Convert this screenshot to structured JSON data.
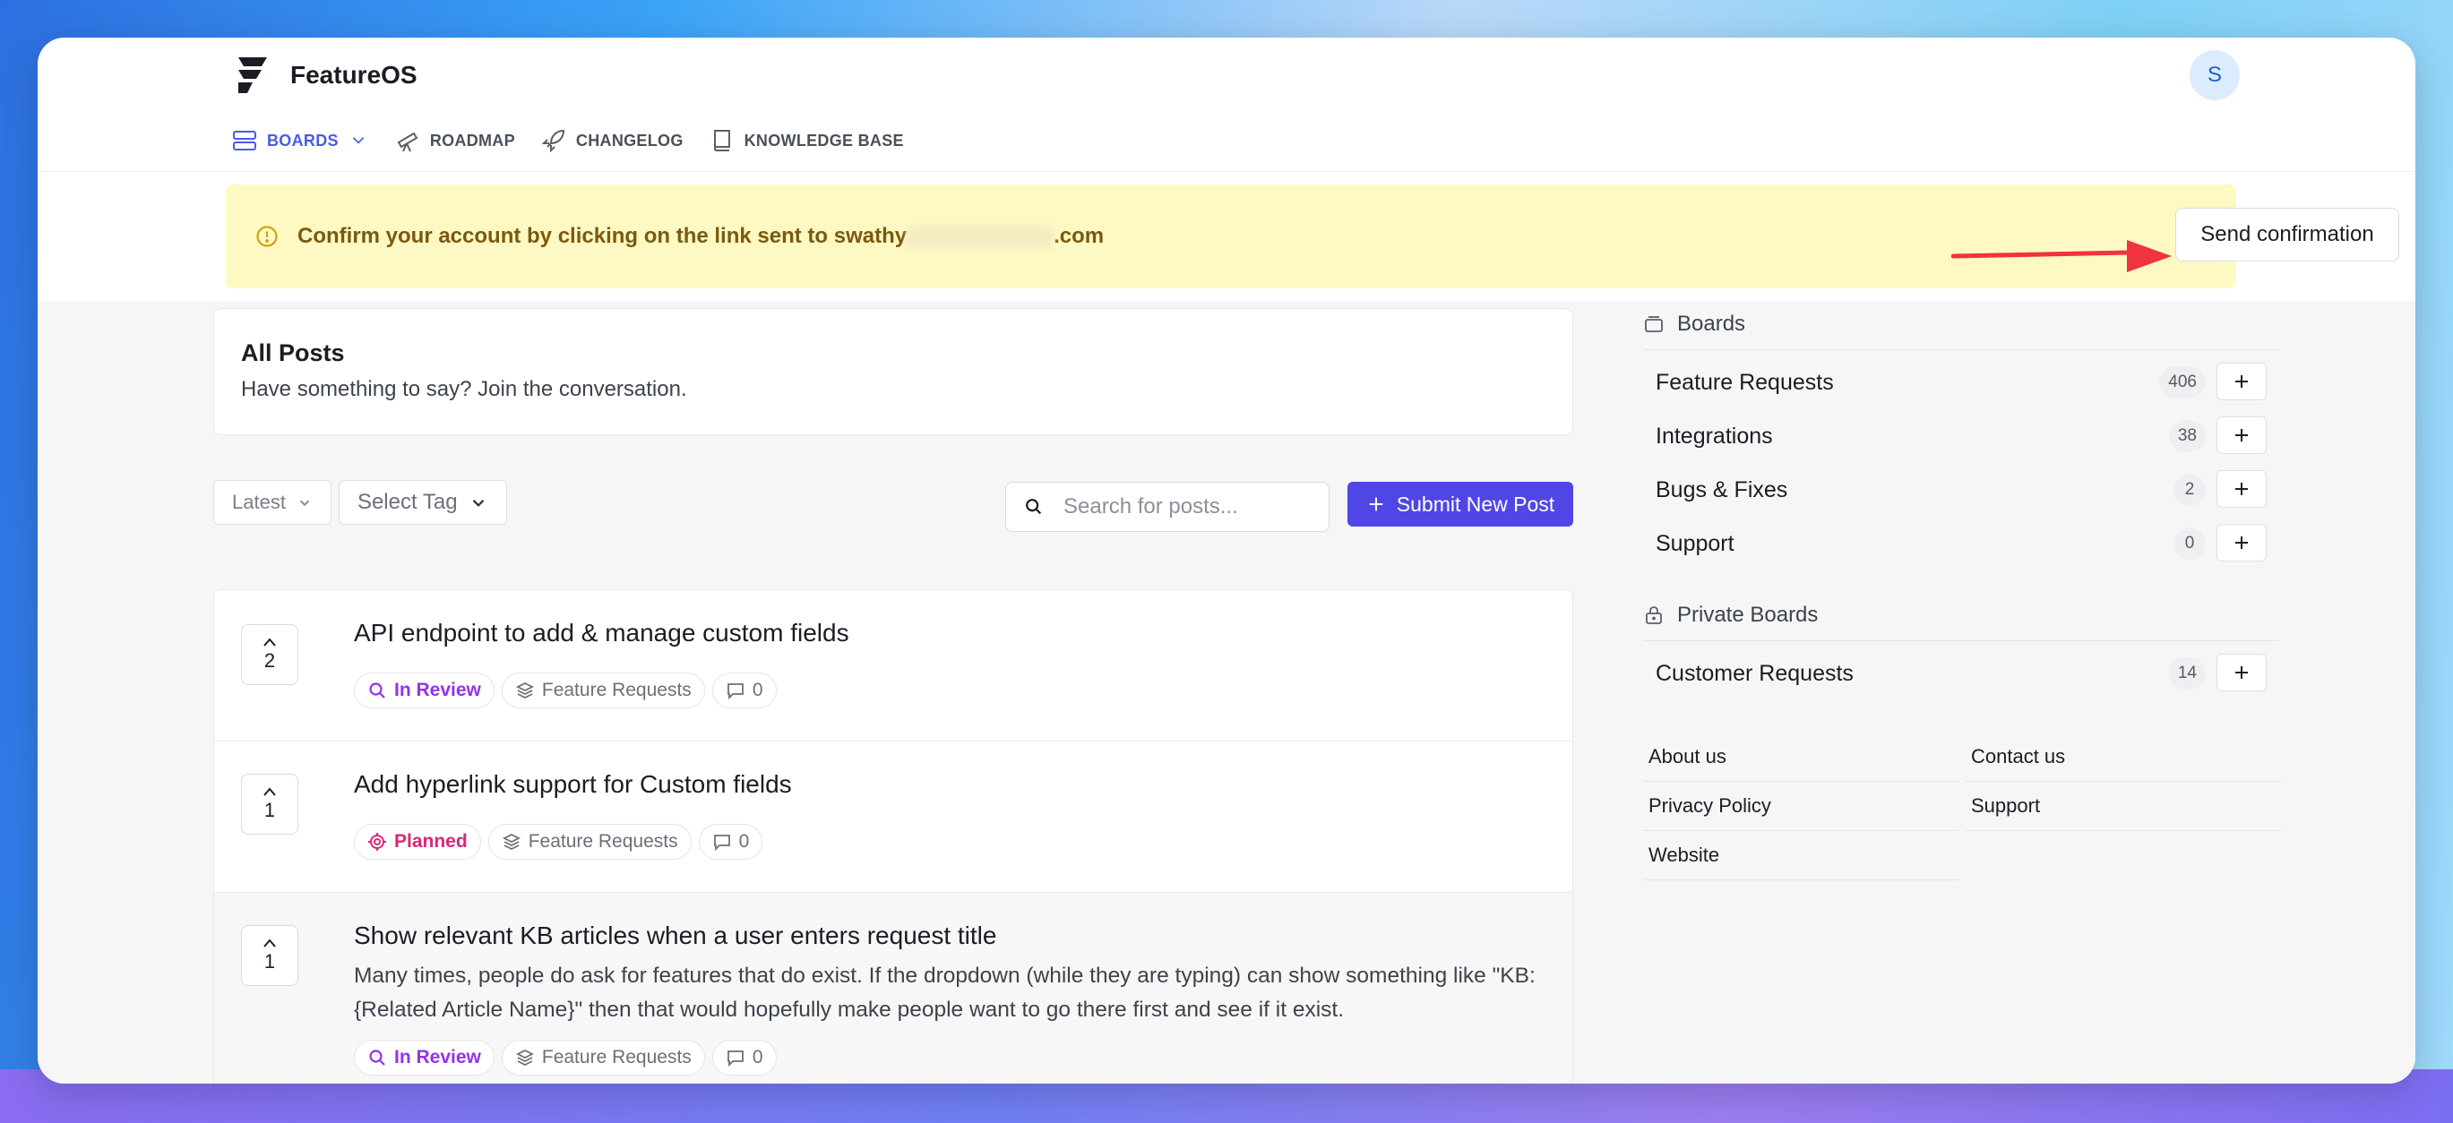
{
  "app": {
    "name": "FeatureOS",
    "avatar_initial": "S"
  },
  "nav": {
    "items": [
      {
        "label": "BOARDS",
        "icon": "boards-icon",
        "active": true
      },
      {
        "label": "ROADMAP",
        "icon": "telescope-icon"
      },
      {
        "label": "CHANGELOG",
        "icon": "rocket-icon"
      },
      {
        "label": "KNOWLEDGE BASE",
        "icon": "book-icon"
      }
    ]
  },
  "banner": {
    "text_prefix": "Confirm your account by clicking on the link sent to swathy",
    "text_suffix": ".com",
    "button_label": "Send confirmation"
  },
  "main": {
    "title": "All Posts",
    "subtitle": "Have something to say? Join the conversation.",
    "sort_label": "Latest",
    "tag_label": "Select Tag",
    "search_placeholder": "Search for posts...",
    "submit_label": "Submit New Post",
    "posts": [
      {
        "votes": "2",
        "title": "API endpoint to add & manage custom fields",
        "status": "In Review",
        "board": "Feature Requests",
        "comments": "0"
      },
      {
        "votes": "1",
        "title": "Add hyperlink support for Custom fields",
        "status": "Planned",
        "board": "Feature Requests",
        "comments": "0"
      },
      {
        "votes": "1",
        "title": "Show relevant KB articles when a user enters request title",
        "description": "Many times, people do ask for features that do exist.  If the dropdown (while they are typing) can show something like \"KB: {Related Article Name}\" then that would hopefully make people want to go there first and see if it exist.",
        "status": "In Review",
        "board": "Feature Requests",
        "comments": "0"
      }
    ]
  },
  "sidebar": {
    "boards_heading": "Boards",
    "boards": [
      {
        "name": "Feature Requests",
        "count": "406"
      },
      {
        "name": "Integrations",
        "count": "38"
      },
      {
        "name": "Bugs & Fixes",
        "count": "2"
      },
      {
        "name": "Support",
        "count": "0"
      }
    ],
    "private_heading": "Private Boards",
    "private_boards": [
      {
        "name": "Customer Requests",
        "count": "14"
      }
    ],
    "links": [
      "About us",
      "Contact us",
      "Privacy Policy",
      "Support",
      "Website"
    ]
  },
  "colors": {
    "accent": "#4f46e5",
    "banner_bg": "#fef9c3",
    "in_review": "#9333ea",
    "planned": "#db2777",
    "arrow": "#ef3340"
  }
}
